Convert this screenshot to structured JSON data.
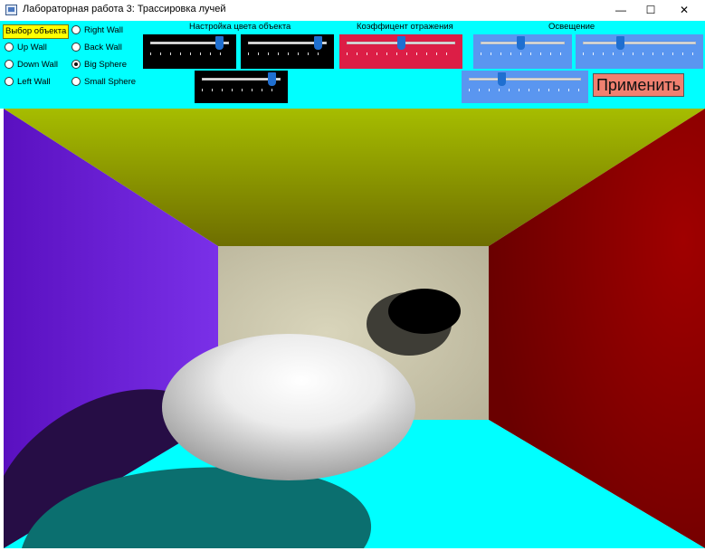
{
  "window": {
    "title": "Лабораторная работа 3: Трассировка лучей",
    "controls": {
      "minimize": "—",
      "maximize": "☐",
      "close": "✕"
    }
  },
  "object_selection": {
    "label": "Выбор объекта",
    "options": [
      {
        "label": "Right Wall",
        "selected": false
      },
      {
        "label": "Up Wall",
        "selected": false
      },
      {
        "label": "Back Wall",
        "selected": false
      },
      {
        "label": "Down Wall",
        "selected": false
      },
      {
        "label": "Big Sphere",
        "selected": true
      },
      {
        "label": "Left Wall",
        "selected": false
      },
      {
        "label": "Small Sphere",
        "selected": false
      }
    ]
  },
  "color_settings": {
    "label": "Настройка цвета объекта",
    "sliders": [
      {
        "name": "red",
        "level": 0.87
      },
      {
        "name": "green",
        "level": 0.88
      },
      {
        "name": "blue",
        "level": 0.88
      }
    ]
  },
  "reflection": {
    "label": "Коэффицент отражения",
    "level": 0.5
  },
  "lighting": {
    "label": "Освещение",
    "sliders": [
      {
        "name": "light-x",
        "level": 0.47
      },
      {
        "name": "light-y",
        "level": 0.33
      },
      {
        "name": "light-z",
        "level": 0.29
      }
    ]
  },
  "apply_button": {
    "label": "Применить"
  },
  "colors": {
    "panel_bg": "#00ffff",
    "color_slider_bg": "#000000",
    "reflection_slider_bg": "#dc1e46",
    "lighting_slider_bg": "#5a96f0",
    "apply_bg": "#f08070",
    "selection_tag_bg": "#ffff00",
    "slider_thumb": "#1f6fd0",
    "scene": {
      "left_wall": "#5a10c0",
      "ceiling": "#a0b000",
      "back_wall": "#cfcbb0",
      "right_wall": "#8a0000",
      "floor": "#00ffff",
      "big_sphere": "#ffffff",
      "small_sphere": "#000000"
    }
  }
}
